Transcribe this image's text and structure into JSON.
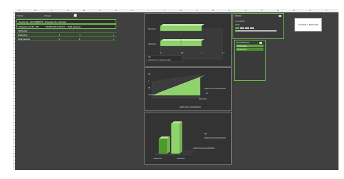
{
  "top_left": {
    "fecha_label": "FECHA",
    "fecha_value": "(Todas)",
    "row1": {
      "a": "Cuenta de",
      "b": "VACUNERITO",
      "c": "Etiquetas de columna"
    },
    "row2": {
      "a": "Etiquetas de fila",
      "b": "NO",
      "c": "SARS COV-2 VACU...",
      "d": "Total general"
    },
    "rows": [
      {
        "label": "Arbitrarias",
        "v": ""
      },
      {
        "label": "Diciembre",
        "v1": "1",
        "v2": "1",
        "v3": "1"
      },
      {
        "label": "Total general",
        "v1": "1",
        "v2": "1",
        "v3": "1"
      }
    ]
  },
  "chart1": {
    "legend_header": "NO",
    "legend_series": "SARS COV-2 VACUNACION",
    "cat_labels": [
      "Diciembre",
      "Arbitrarias"
    ],
    "axis_ticks": [
      "0",
      "0.5",
      "1",
      "1.5"
    ]
  },
  "chart2": {
    "legend_series": "SARS COV-2 VACUNACION",
    "legend_no": "NO",
    "x_labels": [
      "Arbitrarias",
      "Diciembre"
    ],
    "y_ticks": [
      "0",
      "0.5",
      "1",
      "1.5"
    ]
  },
  "chart3": {
    "legend_no": "NO",
    "legend_series": "SARS COV-2 VACUNACION",
    "x_labels": [
      "Arbitrarias",
      "Diciembre"
    ]
  },
  "chart_data": [
    {
      "type": "bar",
      "categories": [
        "Diciembre",
        "Arbitrarias"
      ],
      "series": [
        {
          "name": "SARS COV-2 VACUNACION",
          "values": [
            1,
            1
          ]
        }
      ],
      "xlim": [
        0,
        1.5
      ]
    },
    {
      "type": "area",
      "categories": [
        "Arbitrarias",
        "Diciembre"
      ],
      "series": [
        {
          "name": "SARS COV-2 VACUNACION",
          "values": [
            0,
            1
          ]
        }
      ],
      "ylim": [
        0,
        1.5
      ]
    },
    {
      "type": "bar",
      "categories": [
        "Arbitrarias",
        "Diciembre"
      ],
      "series": [
        {
          "name": "SARS COV-2 VACUNACION",
          "values": [
            0.5,
            1
          ]
        }
      ]
    }
  ],
  "slicer_fecha": {
    "title": "FECHA",
    "subtitle": "ALL DATE",
    "year": "2021",
    "months": [
      "ENE",
      "FEB",
      "MAR",
      "ABR"
    ]
  },
  "slicer_vacunerito": {
    "title": "VACUNERITO",
    "items": [
      "Arbitrarias",
      "Diciembre"
    ]
  },
  "button": {
    "label": "VOLVER A MENÚ DE"
  },
  "colors": {
    "accent": "#69c14b",
    "sheet": "#404040",
    "bar": "#8fd36c"
  }
}
